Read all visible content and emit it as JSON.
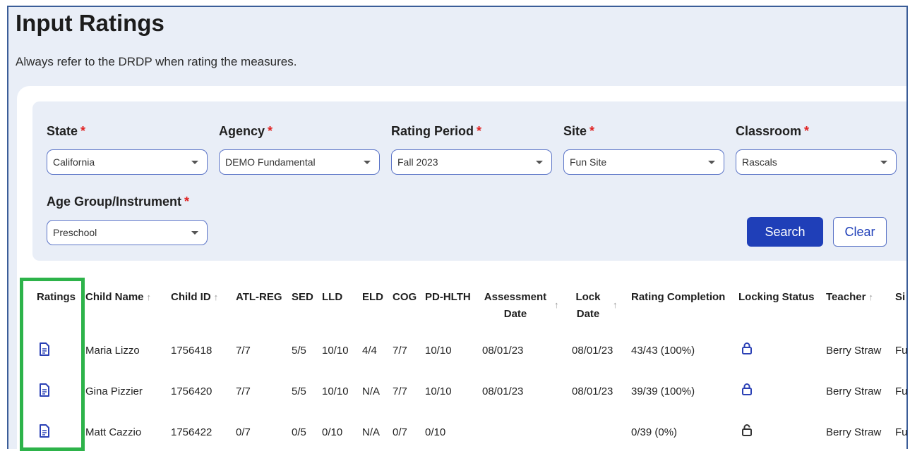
{
  "page": {
    "title": "Input Ratings",
    "subtitle": "Always refer to the DRDP when rating the measures."
  },
  "filters": {
    "state": {
      "label": "State",
      "value": "California"
    },
    "agency": {
      "label": "Agency",
      "value": "DEMO Fundamental"
    },
    "rating_period": {
      "label": "Rating Period",
      "value": "Fall 2023"
    },
    "site": {
      "label": "Site",
      "value": "Fun Site"
    },
    "classroom": {
      "label": "Classroom",
      "value": "Rascals"
    },
    "age_group": {
      "label": "Age Group/Instrument",
      "value": "Preschool"
    },
    "required_mark": "*",
    "search_label": "Search",
    "clear_label": "Clear"
  },
  "table": {
    "headers": {
      "ratings": "Ratings",
      "child_name": "Child Name",
      "child_id": "Child ID",
      "atl_reg": "ATL-REG",
      "sed": "SED",
      "lld": "LLD",
      "eld": "ELD",
      "cog": "COG",
      "pd_hlth": "PD-HLTH",
      "assessment_date_1": "Assessment",
      "assessment_date_2": "Date",
      "lock_date_1": "Lock",
      "lock_date_2": "Date",
      "rating_completion": "Rating Completion",
      "locking_status": "Locking Status",
      "teacher": "Teacher",
      "site": "Si"
    },
    "sort_glyph": "↑",
    "rows": [
      {
        "child_name": "Maria Lizzo",
        "child_id": "1756418",
        "atl_reg": "7/7",
        "sed": "5/5",
        "lld": "10/10",
        "eld": "4/4",
        "cog": "7/7",
        "pd_hlth": "10/10",
        "assessment_date": "08/01/23",
        "lock_date": "08/01/23",
        "rating_completion": "43/43 (100%)",
        "locked": true,
        "teacher": "Berry Straw",
        "site": "Fu"
      },
      {
        "child_name": "Gina Pizzier",
        "child_id": "1756420",
        "atl_reg": "7/7",
        "sed": "5/5",
        "lld": "10/10",
        "eld": "N/A",
        "cog": "7/7",
        "pd_hlth": "10/10",
        "assessment_date": "08/01/23",
        "lock_date": "08/01/23",
        "rating_completion": "39/39 (100%)",
        "locked": true,
        "teacher": "Berry Straw",
        "site": "Fu"
      },
      {
        "child_name": "Matt Cazzio",
        "child_id": "1756422",
        "atl_reg": "0/7",
        "sed": "0/5",
        "lld": "0/10",
        "eld": "N/A",
        "cog": "0/7",
        "pd_hlth": "0/10",
        "assessment_date": "",
        "lock_date": "",
        "rating_completion": "0/39 (0%)",
        "locked": false,
        "teacher": "Berry Straw",
        "site": "Fu"
      }
    ]
  },
  "colors": {
    "accent": "#1f3fb8",
    "highlight": "#2db34a",
    "required": "#e02020"
  },
  "icons": {
    "rating": "document-icon",
    "locked": "lock-closed-icon",
    "unlocked": "lock-open-icon"
  }
}
